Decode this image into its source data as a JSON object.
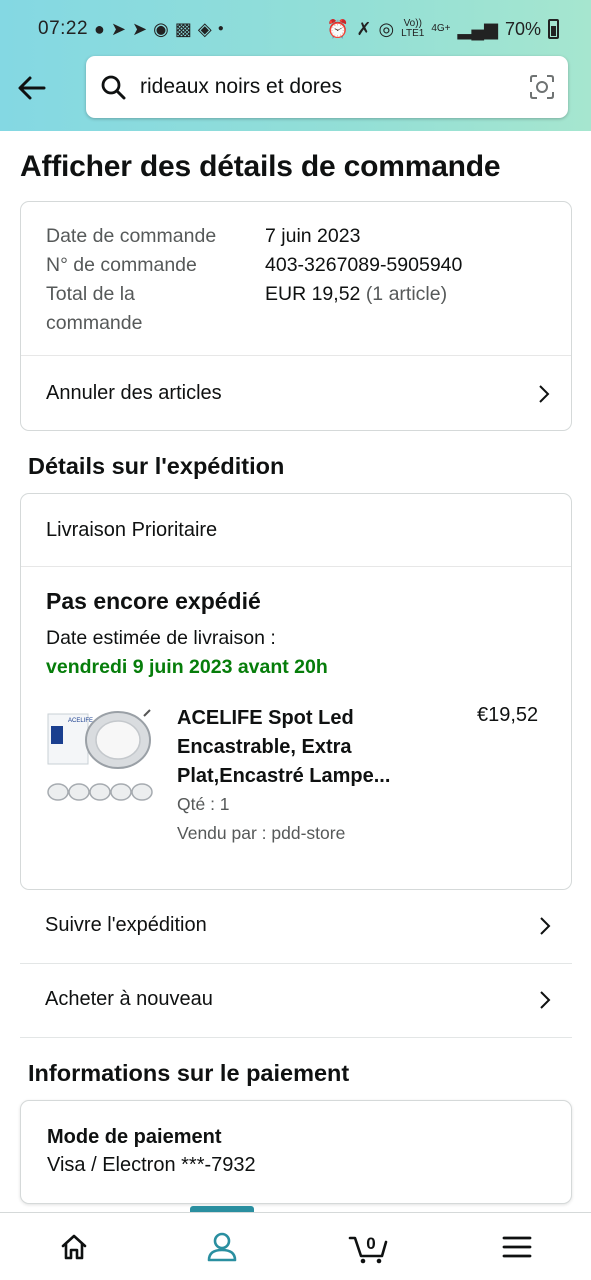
{
  "status_bar": {
    "time": "07:22",
    "battery": "70%",
    "network_top": "Vo))",
    "network_bottom": "LTE1",
    "net_type": "4G+"
  },
  "search": {
    "value": "rideaux noirs et dores"
  },
  "page_title": "Afficher des détails de commande",
  "order": {
    "date_label": "Date de commande",
    "date_value": "7 juin 2023",
    "number_label": "N° de commande",
    "number_value": "403-3267089-5905940",
    "total_label_line1": "Total de la",
    "total_label_line2": "commande",
    "total_value": "EUR 19,52",
    "total_count": "(1 article)",
    "cancel_label": "Annuler des articles"
  },
  "shipping": {
    "section_title": "Détails sur l'expédition",
    "method": "Livraison Prioritaire",
    "status": "Pas encore expédié",
    "eta_label": "Date estimée de livraison :",
    "eta_value": "vendredi 9 juin 2023 avant 20h",
    "accent_color": "#067d0a",
    "product": {
      "title": "ACELIFE Spot Led Encastrable, Extra Plat,Encastré Lampe...",
      "price": "€19,52",
      "qty": "Qté : 1",
      "seller": "Vendu par : pdd-store",
      "thumb_brand": "ACELIFE"
    }
  },
  "actions": {
    "track": "Suivre l'expédition",
    "buy_again": "Acheter à nouveau"
  },
  "payment": {
    "section_title": "Informations sur le paiement",
    "method_title": "Mode de paiement",
    "method_value": "Visa / Electron ***-7932"
  },
  "bottom_nav": {
    "cart_count": "0",
    "active": "account",
    "active_color": "#2a8fa0"
  }
}
